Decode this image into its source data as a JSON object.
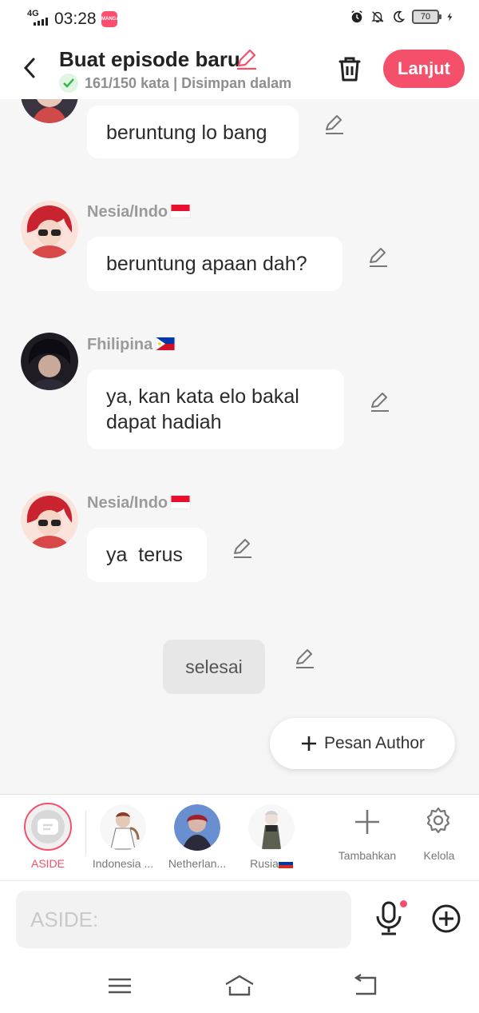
{
  "status": {
    "network": "4G",
    "time": "03:28",
    "app_badge": "MANGATOON",
    "battery": "70"
  },
  "header": {
    "title": "Buat episode baru",
    "subtitle": "161/150 kata | Disimpan dalam",
    "next_label": "Lanjut",
    "accent": "#f5506b"
  },
  "messages": [
    {
      "name": "",
      "text": "beruntung lo bang"
    },
    {
      "name": "Nesia/Indo",
      "flag": "indonesia",
      "text": "beruntung apaan dah?"
    },
    {
      "name": "Fhilipina",
      "flag": "philippines",
      "text_line1": "ya, kan kata elo bakal",
      "text_line2": "dapat hadiah"
    },
    {
      "name": "Nesia/Indo",
      "flag": "indonesia",
      "text": "ya  terus"
    }
  ],
  "aside_message": "selesai",
  "author_button": "Pesan Author",
  "characters": [
    {
      "label": "ASIDE",
      "color": "#f5506b"
    },
    {
      "label": "Indonesia ..."
    },
    {
      "label": "Netherlan..."
    },
    {
      "label": "Rusia",
      "flag": "russia"
    }
  ],
  "actions": {
    "add_label": "Tambahkan",
    "manage_label": "Kelola"
  },
  "composer": {
    "placeholder": "ASIDE:"
  }
}
